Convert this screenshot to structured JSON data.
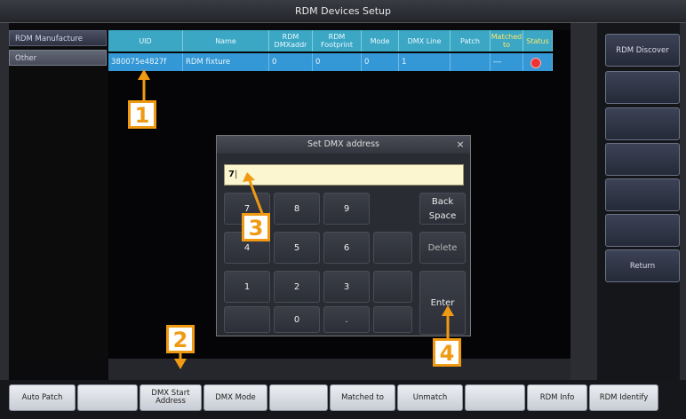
{
  "window": {
    "title": "RDM Devices Setup"
  },
  "sidebar": {
    "items": [
      "RDM Manufacture",
      "Other"
    ]
  },
  "table": {
    "headers": [
      "UID",
      "Name",
      "RDM\nDMXaddr",
      "RDM\nFootprint",
      "Mode",
      "DMX Line",
      "Patch",
      "Matched\nto",
      "Status"
    ],
    "row": [
      "380075e4827f",
      "RDM fixture",
      "0",
      "0",
      "0",
      "1",
      "",
      "---",
      ""
    ]
  },
  "right_buttons": [
    "RDM Discover",
    "",
    "",
    "",
    "",
    "",
    "Return"
  ],
  "bottom_buttons": [
    "Auto Patch",
    "",
    "DMX Start\nAddress",
    "DMX Mode",
    "",
    "Matched to",
    "Unmatch",
    "",
    "RDM Info",
    "RDM Identify"
  ],
  "dialog": {
    "title": "Set DMX address",
    "close": "×",
    "value": "7",
    "keys": [
      "7",
      "8",
      "9",
      "",
      "Back\nSpace",
      "4",
      "5",
      "6",
      "",
      "Delete",
      "1",
      "2",
      "3",
      "",
      "Enter",
      "",
      "0",
      ".",
      ""
    ]
  },
  "callouts": [
    "1",
    "2",
    "3",
    "4"
  ],
  "colors": {
    "callout": "#f09a14",
    "header": "#3ba7c4",
    "row": "#3398d5",
    "status": "#e33333"
  }
}
